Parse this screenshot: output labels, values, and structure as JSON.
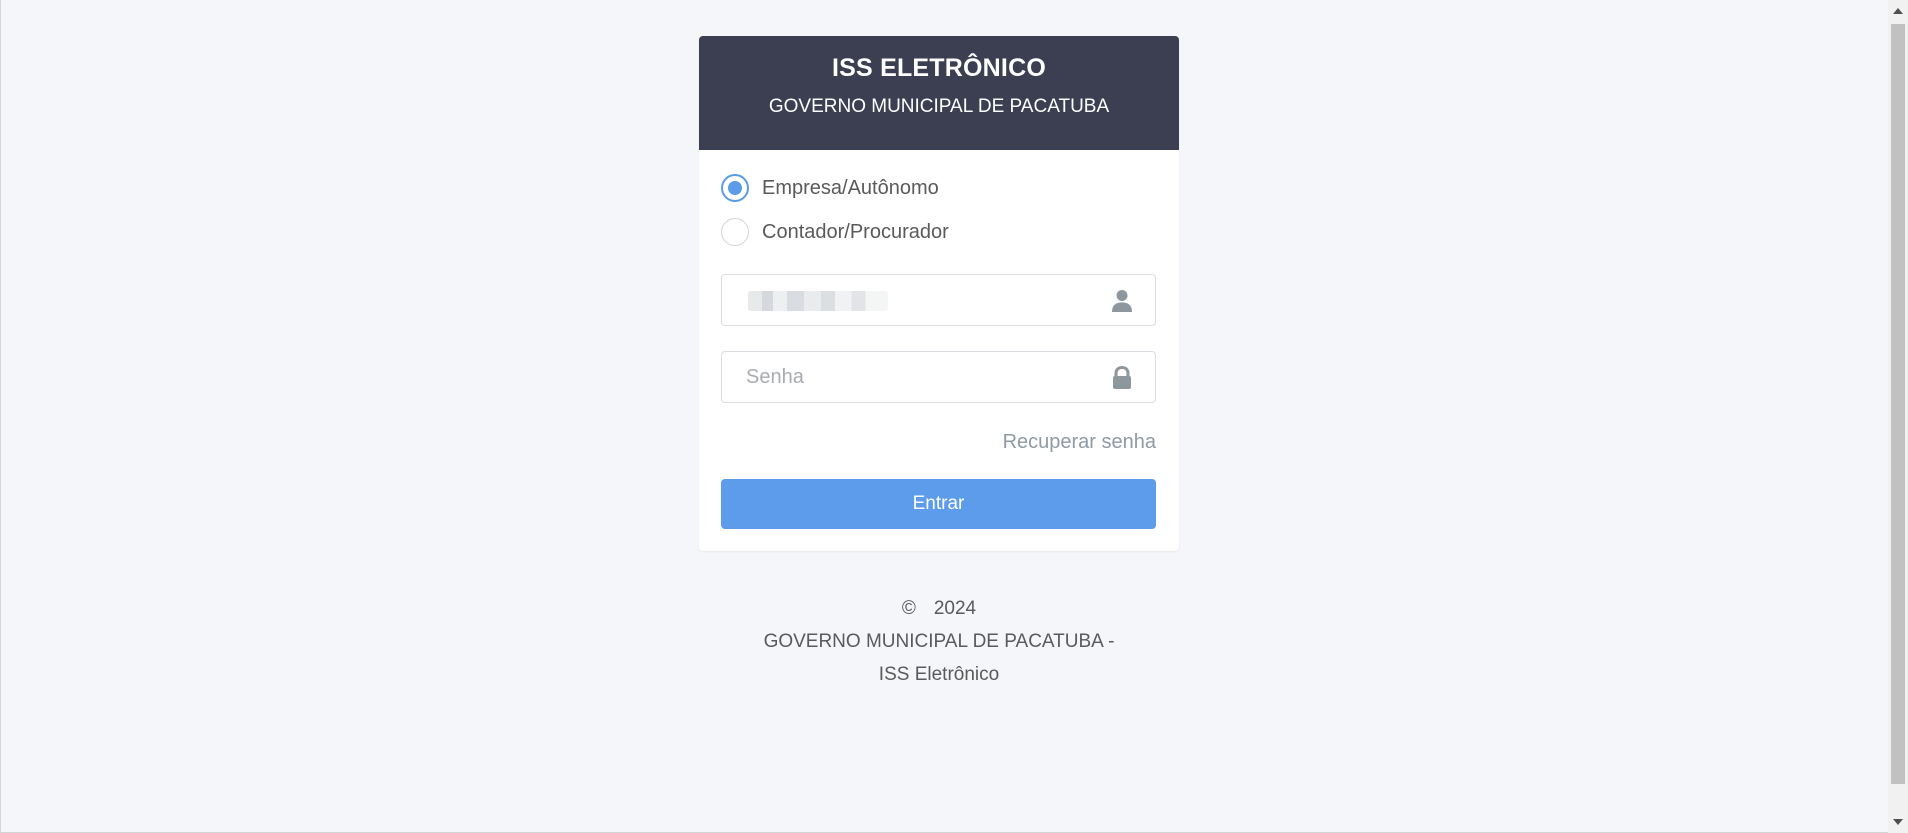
{
  "header": {
    "title": "ISS ELETRÔNICO",
    "subtitle": "GOVERNO MUNICIPAL DE PACATUBA"
  },
  "login_type": {
    "options": [
      {
        "label": "Empresa/Autônomo",
        "selected": true
      },
      {
        "label": "Contador/Procurador",
        "selected": false
      }
    ]
  },
  "fields": {
    "user_value": "",
    "user_icon": "user-icon",
    "password_placeholder": "Senha",
    "password_icon": "lock-icon"
  },
  "links": {
    "recover_password": "Recuperar senha"
  },
  "actions": {
    "submit_label": "Entrar"
  },
  "footer": {
    "copyright_symbol": "©",
    "year": "2024",
    "org": "GOVERNO MUNICIPAL DE PACATUBA - ISS Eletrônico"
  },
  "colors": {
    "header_bg": "#3b3f51",
    "accent": "#5d9ceb",
    "page_bg": "#f5f6fa",
    "icon": "#8e969e"
  }
}
